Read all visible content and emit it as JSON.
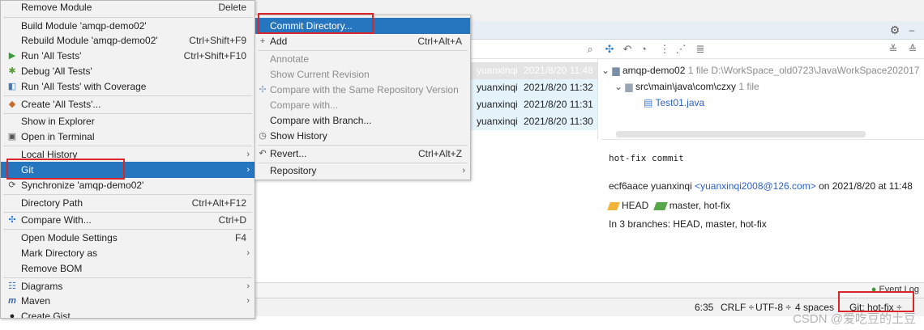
{
  "left_menu": {
    "items": [
      {
        "label": "Remove Module",
        "shortcut": "Delete",
        "icon": ""
      },
      {
        "label": "Build Module 'amqp-demo02'",
        "shortcut": "",
        "icon": ""
      },
      {
        "label": "Rebuild Module 'amqp-demo02'",
        "shortcut": "Ctrl+Shift+F9",
        "icon": ""
      },
      {
        "label": "Run 'All Tests'",
        "shortcut": "Ctrl+Shift+F10",
        "icon": "run-icon"
      },
      {
        "label": "Debug 'All Tests'",
        "shortcut": "",
        "icon": "debug-icon"
      },
      {
        "label": "Run 'All Tests' with Coverage",
        "shortcut": "",
        "icon": "coverage-icon"
      },
      {
        "label": "Create 'All Tests'...",
        "shortcut": "",
        "icon": "create-config-icon"
      },
      {
        "label": "Show in Explorer",
        "shortcut": "",
        "icon": ""
      },
      {
        "label": "Open in Terminal",
        "shortcut": "",
        "icon": "terminal-icon"
      },
      {
        "label": "Local History",
        "shortcut": "",
        "icon": ""
      },
      {
        "label": "Git",
        "shortcut": "",
        "icon": ""
      },
      {
        "label": "Synchronize 'amqp-demo02'",
        "shortcut": "",
        "icon": "sync-icon"
      },
      {
        "label": "Directory Path",
        "shortcut": "Ctrl+Alt+F12",
        "icon": ""
      },
      {
        "label": "Compare With...",
        "shortcut": "Ctrl+D",
        "icon": "compare-icon"
      },
      {
        "label": "Open Module Settings",
        "shortcut": "F4",
        "icon": ""
      },
      {
        "label": "Mark Directory as",
        "shortcut": "",
        "icon": ""
      },
      {
        "label": "Remove BOM",
        "shortcut": "",
        "icon": ""
      },
      {
        "label": "Diagrams",
        "shortcut": "",
        "icon": "diagrams-icon"
      },
      {
        "label": "Maven",
        "shortcut": "",
        "icon": "maven-icon"
      },
      {
        "label": "Create Gist...",
        "shortcut": "",
        "icon": "github-icon"
      }
    ]
  },
  "git_submenu": {
    "items": [
      {
        "label": "Commit Directory...",
        "shortcut": ""
      },
      {
        "label": "Add",
        "shortcut": "Ctrl+Alt+A"
      },
      {
        "label": "Annotate",
        "shortcut": ""
      },
      {
        "label": "Show Current Revision",
        "shortcut": ""
      },
      {
        "label": "Compare with the Same Repository Version",
        "shortcut": ""
      },
      {
        "label": "Compare with...",
        "shortcut": ""
      },
      {
        "label": "Compare with Branch...",
        "shortcut": ""
      },
      {
        "label": "Show History",
        "shortcut": ""
      },
      {
        "label": "Revert...",
        "shortcut": "Ctrl+Alt+Z"
      },
      {
        "label": "Repository",
        "shortcut": ""
      }
    ]
  },
  "git_log": {
    "commits": [
      {
        "author": "yuanxinqi",
        "date": "2021/8/20 11:48"
      },
      {
        "author": "yuanxinqi",
        "date": "2021/8/20 11:32"
      },
      {
        "author": "yuanxinqi",
        "date": "2021/8/20 11:31"
      },
      {
        "author": "yuanxinqi",
        "date": "2021/8/20 11:30"
      }
    ],
    "tree": {
      "module": "amqp-demo02",
      "module_count": "1 file",
      "module_path": "D:\\WorkSpace_old0723\\JavaWorkSpace202017",
      "package": "src\\main\\java\\com\\czxy",
      "package_count": "1 file",
      "file": "Test01.java"
    },
    "detail": {
      "message": "hot-fix commit",
      "hash": "ecf6aace",
      "author": "yuanxinqi",
      "email": "<yuanxinqi2008@126.com>",
      "on_text": "on 2021/8/20 at 11:48",
      "head": "HEAD",
      "branches_refs": "master, hot-fix",
      "in_branches": "In 3 branches: HEAD, master, hot-fix"
    }
  },
  "status_bar": {
    "position": "6:35",
    "line_sep": "CRLF ÷",
    "encoding": "UTF-8 ÷",
    "indent": "4 spaces",
    "git_branch": "Git: hot-fix ÷",
    "event_log": "Event Log"
  },
  "watermark": "CSDN @爱吃豆的土豆",
  "colors": {
    "selection": "#2675bf",
    "highlight_box": "#d9262b",
    "link": "#2d62c8"
  }
}
